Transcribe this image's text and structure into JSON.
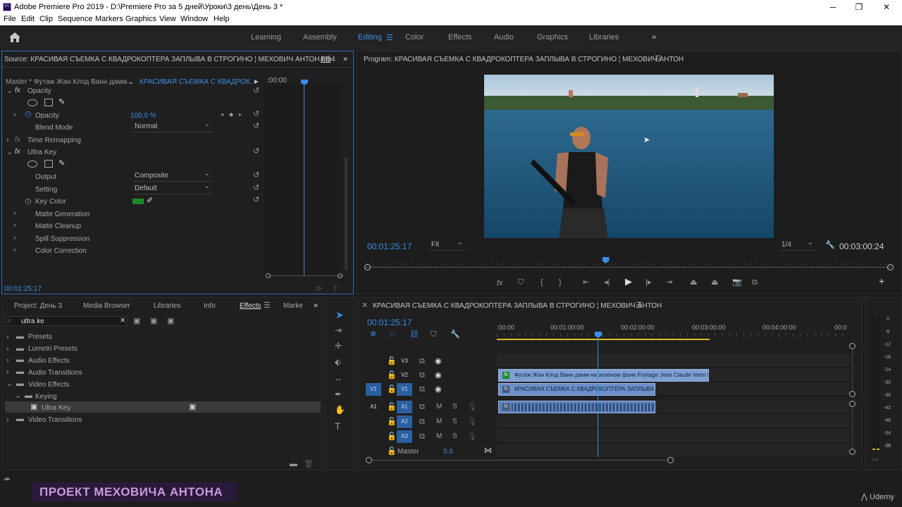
{
  "window": {
    "title": "Adobe Premiere Pro 2019 - D:\\Premiere Pro  за 5 дней\\Уроки\\3 день\\День 3 *",
    "app_icon_label": "Pr"
  },
  "menu": [
    "File",
    "Edit",
    "Clip",
    "Sequence",
    "Markers",
    "Graphics",
    "View",
    "Window",
    "Help"
  ],
  "workspaces": [
    "Learning",
    "Assembly",
    "Editing",
    "Color",
    "Effects",
    "Audio",
    "Graphics",
    "Libraries"
  ],
  "active_workspace": "Editing",
  "effect_controls": {
    "source_title": "Source: КРАСИВАЯ СЪЕМКА С КВАДРОКОПТЕРА ЗАПЛЫВА В СТРОГИНО ¦ МЕХОВИЧ АНТОН.mp4",
    "tab_short": "Effi",
    "master_label": "Master * Футаж Жан Клод Ванн дамм...",
    "clip_label": "КРАСИВАЯ СЪЕМКА С КВАДРОК...",
    "timecode_start": ":00:00",
    "opacity_section": "Opacity",
    "opacity_label": "Opacity",
    "opacity_value": "100,0 %",
    "blend_mode_label": "Blend Mode",
    "blend_mode_value": "Normal",
    "time_remapping": "Time Remapping",
    "ultra_key": "Ultra Key",
    "output_label": "Output",
    "output_value": "Composite",
    "setting_label": "Setting",
    "setting_value": "Default",
    "key_color_label": "Key Color",
    "key_color": "#1e8a2a",
    "matte_generation": "Matte Generation",
    "matte_cleanup": "Matte Cleanup",
    "spill_suppression": "Spill Suppression",
    "color_correction": "Color Correction",
    "timecode": "00:01:25:17"
  },
  "program_monitor": {
    "title": "Program: КРАСИВАЯ СЪЕМКА С КВАДРОКОПТЕРА ЗАПЛЫВА В СТРОГИНО ¦ МЕХОВИЧ АНТОН",
    "timecode": "00:01:25:17",
    "fit": "Fit",
    "resolution": "1/4",
    "duration": "00:03:00:24",
    "playhead_progress": 0.455
  },
  "project_panel": {
    "tabs": [
      "Project: День 3",
      "Media Browser",
      "Libraries",
      "Info",
      "Effects",
      "Marke"
    ],
    "active_tab": "Effects",
    "search_value": "ultra ke",
    "tree": [
      "Presets",
      "Lumetri Presets",
      "Audio Effects",
      "Audio Transitions",
      "Video Effects",
      "Keying",
      "Ultra Key",
      "Video Transitions"
    ]
  },
  "timeline": {
    "title": "КРАСИВАЯ СЪЕМКА С КВАДРОКОПТЕРА ЗАПЛЫВА В СТРОГИНО ¦ МЕХОВИЧ АНТОН",
    "timecode": "00:01:25:17",
    "ruler": [
      ":00:00",
      "00:01:00:00",
      "00:02:00:00",
      "00:03:00:00",
      "00:04:00:00",
      "00:0"
    ],
    "tracks_video": [
      "V3",
      "V2",
      "V1"
    ],
    "tracks_audio": [
      "A1",
      "A2",
      "A3"
    ],
    "source_v": "V1",
    "source_a": "A1",
    "mute": "M",
    "solo": "S",
    "master_label": "Master",
    "master_value": "0,0",
    "clip_v2": "Футаж Жан Клод Ванн дамм на зеленом фоне.Footage Jean Claude Vann Da",
    "clip_v1": "КРАСИВАЯ СЪЕМКА С КВАДРОКОПТЕРА ЗАПЛЫВА В С",
    "fx_badge": "fx"
  },
  "audio_meter": {
    "scale": [
      "0",
      "-6",
      "-12",
      "-18",
      "-24",
      "-30",
      "-36",
      "-42",
      "-48",
      "-54",
      "dB"
    ]
  },
  "watermark": "ПРОЕКТ МЕХОВИЧА АНТОНА",
  "brand": "Udemy",
  "colors": {
    "accent": "#3a8de6",
    "clip_v1": "#6a8fc9",
    "clip_v2": "#7f9fd3",
    "clip_audio": "#5b7fb8"
  }
}
